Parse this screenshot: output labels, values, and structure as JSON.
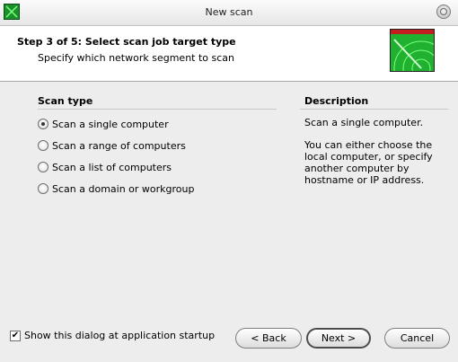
{
  "window": {
    "title": "New scan"
  },
  "header": {
    "step_title": "Step 3 of 5: Select scan job target type",
    "subtitle": "Specify which network segment to scan"
  },
  "scan_type": {
    "heading": "Scan type",
    "options": [
      {
        "label": "Scan a single computer",
        "checked": true
      },
      {
        "label": "Scan a range of computers",
        "checked": false
      },
      {
        "label": "Scan a list of computers",
        "checked": false
      },
      {
        "label": "Scan a domain or workgroup",
        "checked": false
      }
    ]
  },
  "description": {
    "heading": "Description",
    "line1": "Scan a single computer.",
    "line2": "You can either choose the local computer, or specify another computer by hostname or IP address."
  },
  "footer": {
    "startup_checkbox_label": "Show this dialog at application startup",
    "startup_checked": true,
    "back_label": "< Back",
    "next_label": "Next >",
    "cancel_label": "Cancel"
  },
  "colors": {
    "art_green": "#1fb12f",
    "art_band": "#c41e1e"
  }
}
